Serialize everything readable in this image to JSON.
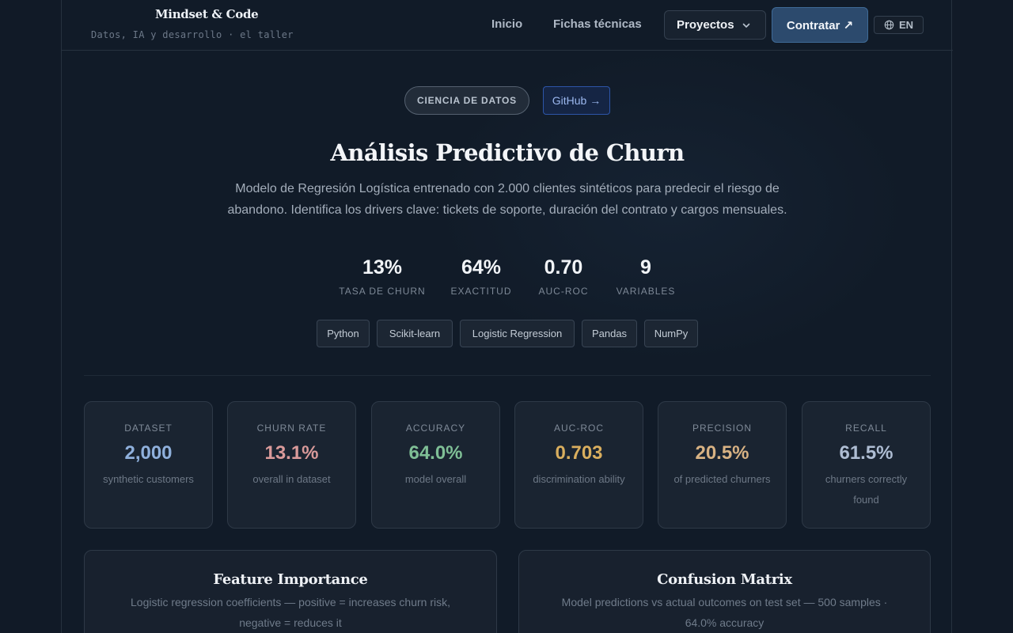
{
  "header": {
    "brand_title": "Mindset & Code",
    "brand_subtitle": "Datos, IA y desarrollo · el taller",
    "nav": {
      "home": "Inicio",
      "datasheets": "Fichas técnicas",
      "projects": "Proyectos",
      "hire": "Contratar ↗",
      "lang": "EN"
    }
  },
  "hero": {
    "category": "CIENCIA DE DATOS",
    "github": "GitHub →",
    "title": "Análisis Predictivo de Churn",
    "description": "Modelo de Regresión Logística entrenado con 2.000 clientes sintéticos para predecir el riesgo de abandono. Identifica los drivers clave: tickets de soporte, duración del contrato y cargos mensuales.",
    "stats": [
      {
        "value": "13%",
        "label": "TASA DE CHURN"
      },
      {
        "value": "64%",
        "label": "EXACTITUD"
      },
      {
        "value": "0.70",
        "label": "AUC-ROC"
      },
      {
        "value": "9",
        "label": "VARIABLES"
      }
    ],
    "tags": [
      "Python",
      "Scikit-learn",
      "Logistic Regression",
      "Pandas",
      "NumPy"
    ]
  },
  "metrics": [
    {
      "label": "DATASET",
      "value": "2,000",
      "sub": "synthetic customers",
      "color": "#8fb0dc"
    },
    {
      "label": "CHURN RATE",
      "value": "13.1%",
      "sub": "overall in dataset",
      "color": "#d99a9a"
    },
    {
      "label": "ACCURACY",
      "value": "64.0%",
      "sub": "model overall",
      "color": "#7fbf96"
    },
    {
      "label": "AUC-ROC",
      "value": "0.703",
      "sub": "discrimination ability",
      "color": "#d9ae5e"
    },
    {
      "label": "PRECISION",
      "value": "20.5%",
      "sub": "of predicted churners",
      "color": "#d8b283"
    },
    {
      "label": "RECALL",
      "value": "61.5%",
      "sub": "churners correctly found",
      "color": "#aebdd3"
    }
  ],
  "panels": {
    "feature_importance": {
      "title": "Feature Importance",
      "description": "Logistic regression coefficients — positive = increases churn risk, negative = reduces it"
    },
    "confusion_matrix": {
      "title": "Confusion Matrix",
      "description": "Model predictions vs actual outcomes on test set — 500 samples · 64.0% accuracy"
    }
  }
}
